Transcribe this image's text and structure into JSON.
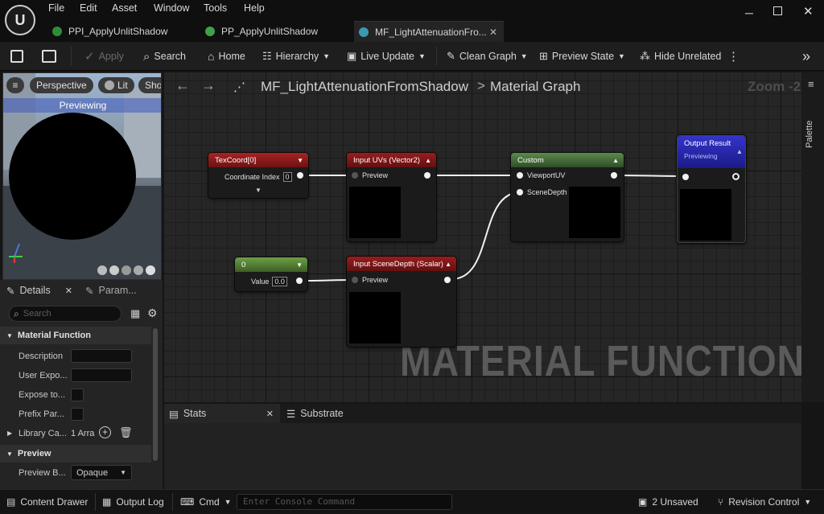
{
  "menu": [
    "File",
    "Edit",
    "Asset",
    "Window",
    "Tools",
    "Help"
  ],
  "tabs": [
    {
      "label": "PPI_ApplyUnlitShadow"
    },
    {
      "label": "PP_ApplyUnlitShadow"
    },
    {
      "label": "MF_LightAttenuationFro..."
    }
  ],
  "toolbar": {
    "apply": "Apply",
    "search": "Search",
    "home": "Home",
    "hierarchy": "Hierarchy",
    "live_update": "Live Update",
    "clean_graph": "Clean Graph",
    "preview_state": "Preview State",
    "hide_unrelated": "Hide Unrelated"
  },
  "viewport": {
    "perspective": "Perspective",
    "lit": "Lit",
    "show": "Show",
    "previewing": "Previewing"
  },
  "details": {
    "tab_details": "Details",
    "tab_params": "Param...",
    "search_placeholder": "Search",
    "section_mf": "Material Function",
    "props": [
      "Description",
      "User Expo...",
      "Expose to...",
      "Prefix Par...",
      "Library Ca..."
    ],
    "library_value": "1 Arra",
    "section_preview": "Preview",
    "preview_label": "Preview B...",
    "preview_value": "Opaque"
  },
  "graph": {
    "breadcrumb_asset": "MF_LightAttenuationFromShadow",
    "breadcrumb_sep": ">",
    "breadcrumb_graph": "Material Graph",
    "zoom": "Zoom -2",
    "watermark": "MATERIAL FUNCTION",
    "palette": "Palette",
    "nodes": {
      "texcoord": {
        "title": "TexCoord[0]",
        "pin": "Coordinate Index",
        "value": "0"
      },
      "input_uvs": {
        "title": "Input UVs (Vector2)",
        "pin": "Preview"
      },
      "custom": {
        "title": "Custom",
        "pin1": "ViewportUV",
        "pin2": "SceneDepth"
      },
      "output": {
        "title": "Output Result",
        "sub": "Previewing"
      },
      "const": {
        "title": "0",
        "pin": "Value",
        "value": "0.0"
      },
      "input_depth": {
        "title": "Input SceneDepth (Scalar)",
        "pin": "Preview"
      }
    }
  },
  "lower_tabs": {
    "stats": "Stats",
    "substrate": "Substrate"
  },
  "statusbar": {
    "content_drawer": "Content Drawer",
    "output_log": "Output Log",
    "cmd": "Cmd",
    "console_placeholder": "Enter Console Command",
    "unsaved": "2 Unsaved",
    "revision": "Revision Control"
  },
  "colors": {
    "texcoord_head": "#9e1f1f",
    "input_head": "#8e1b1b",
    "custom_head": "#4f7a42",
    "output_head": "#2a2ab8",
    "const_head": "#5e8f3a"
  }
}
